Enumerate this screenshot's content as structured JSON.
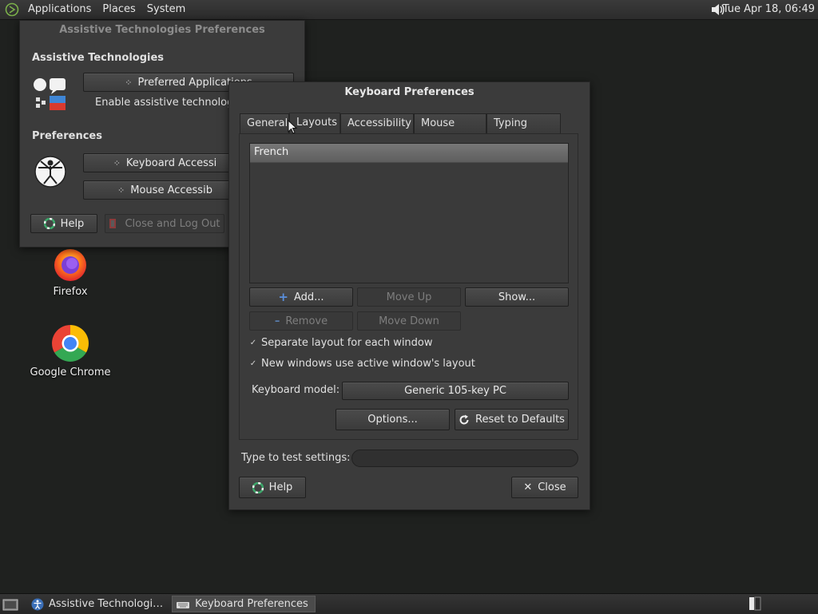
{
  "top_panel": {
    "menus": [
      "Applications",
      "Places",
      "System"
    ],
    "clock": "Tue Apr 18, 06:49"
  },
  "desktop": {
    "icons": [
      {
        "label": "Firefox",
        "icon": "firefox-icon"
      },
      {
        "label": "Google Chrome",
        "icon": "chrome-icon"
      }
    ]
  },
  "at_window": {
    "title": "Assistive Technologies Preferences",
    "section_at": "Assistive Technologies",
    "preferred_apps": "Preferred Applications",
    "enable_at": "Enable assistive technologies",
    "enable_at_checked": false,
    "section_prefs": "Preferences",
    "keyboard_access": "Keyboard Accessi",
    "mouse_access": "Mouse Accessib",
    "help": "Help",
    "close_logout": "Close and Log Out"
  },
  "kb_window": {
    "title": "Keyboard Preferences",
    "tabs": [
      "General",
      "Layouts",
      "Accessibility",
      "Mouse Keys",
      "Typing Break"
    ],
    "active_tab": "Layouts",
    "layouts": [
      "French"
    ],
    "add": "Add...",
    "move_up": "Move Up",
    "show": "Show...",
    "remove": "Remove",
    "move_down": "Move Down",
    "separate_layout": "Separate layout for each window",
    "separate_layout_checked": true,
    "new_windows_layout": "New windows use active window's layout",
    "new_windows_layout_checked": true,
    "keyboard_model_label": "Keyboard model:",
    "keyboard_model_value": "Generic 105-key PC",
    "options": "Options...",
    "reset": "Reset to Defaults",
    "test_label": "Type to test settings:",
    "test_value": "",
    "help": "Help",
    "close": "Close"
  },
  "taskbar": {
    "items": [
      {
        "label": "Assistive Technologi…",
        "active": false
      },
      {
        "label": "Keyboard Preferences",
        "active": true
      }
    ]
  },
  "colors": {
    "desktop": "#1f211f",
    "window": "#3b3b3b",
    "selection": "#6a6a6a"
  }
}
